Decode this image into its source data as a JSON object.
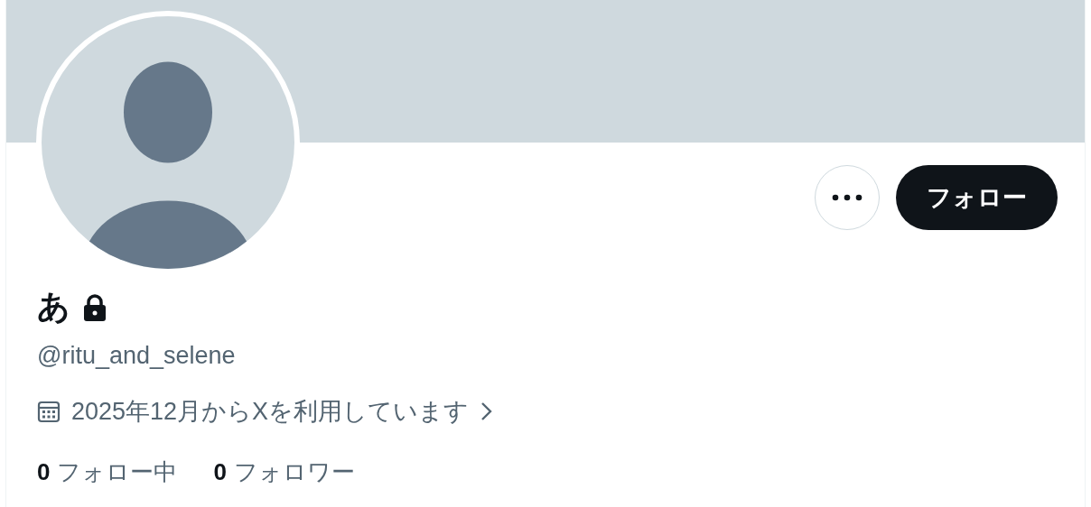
{
  "profile": {
    "name": "あ",
    "locked": true,
    "handle": "@ritu_and_selene",
    "joined": "2025年12月からXを利用しています"
  },
  "follow_button": {
    "label": "フォロー"
  },
  "stats": [
    {
      "count": "0",
      "label": "フォロー中"
    },
    {
      "count": "0",
      "label": "フォロワー"
    }
  ]
}
